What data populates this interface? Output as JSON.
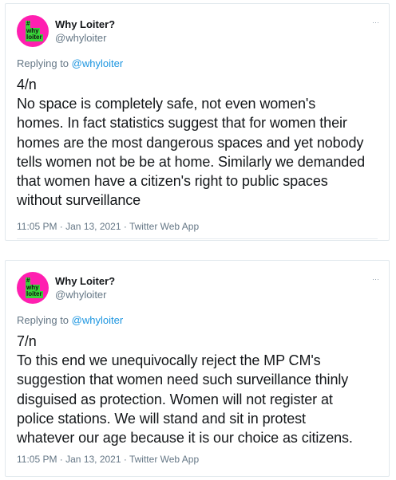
{
  "tweets": [
    {
      "display_name": "Why Loiter?",
      "handle": "@whyloiter",
      "more_icon": "···",
      "replying_prefix": "Replying to ",
      "replying_handle": "@whyloiter",
      "text": "4/n\nNo space is completely safe, not even women's\nhomes. In fact statistics suggest that for women their\nhomes are the most dangerous spaces and yet nobody\ntells women not be be at home. Similarly we demanded\nthat women have a citizen's right to public spaces\nwithout surveillance",
      "meta": "11:05 PM · Jan 13, 2021 · Twitter Web App",
      "avatar": {
        "icon": "why-loiter-logo",
        "lines": [
          "#",
          "why",
          "loiter"
        ]
      }
    },
    {
      "display_name": "Why Loiter?",
      "handle": "@whyloiter",
      "more_icon": "···",
      "replying_prefix": "Replying to ",
      "replying_handle": "@whyloiter",
      "text": "7/n\nTo this end we unequivocally reject the MP CM's\nsuggestion that women need such surveillance thinly\ndisguised as protection. Women will not register at\npolice stations. We will stand and sit in protest\nwhatever our age because it is our choice as citizens.",
      "meta": "11:05 PM · Jan 13, 2021 · Twitter Web App",
      "avatar": {
        "icon": "why-loiter-logo",
        "lines": [
          "#",
          "why",
          "loiter"
        ]
      }
    }
  ],
  "colors": {
    "avatar_bg": "#ff1fb0",
    "avatar_label_bg": "#39d43a",
    "link": "#1b95e0",
    "secondary_text": "#657786",
    "primary_text": "#14171a",
    "border": "#e1e8ed"
  }
}
